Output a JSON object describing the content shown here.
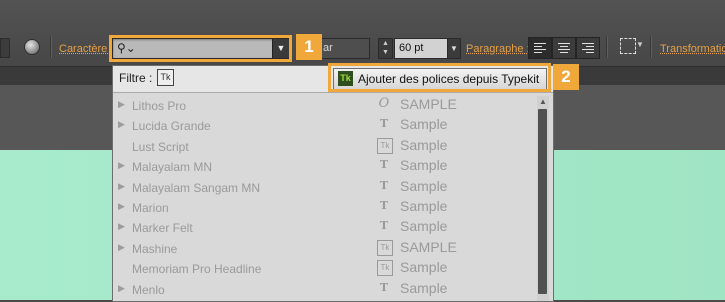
{
  "toolbar": {
    "caractere_label": "Caractère :",
    "font_field_value": "",
    "style_value": "ar",
    "size_value": "60 pt",
    "paragraphe_label": "Paragraphe :",
    "transformation_label": "Transformation"
  },
  "callouts": {
    "one": "1",
    "two": "2"
  },
  "accent_color": "#f0a83a",
  "canvas_color": "#a3e9c9",
  "panel": {
    "filter_label": "Filtre :",
    "filter_icon": "Tk",
    "typekit_icon": "Tk",
    "typekit_button": "Ajouter des polices depuis Typekit",
    "fonts": [
      {
        "name": "Lithos Pro",
        "icon": "O",
        "sample": "SAMPLE",
        "expandable": true
      },
      {
        "name": "Lucida Grande",
        "icon": "T",
        "sample": "Sample",
        "expandable": true
      },
      {
        "name": "Lust Script",
        "icon": "Tk",
        "sample": "Sample",
        "expandable": false
      },
      {
        "name": "Malayalam MN",
        "icon": "T",
        "sample": "Sample",
        "expandable": true
      },
      {
        "name": "Malayalam Sangam MN",
        "icon": "T",
        "sample": "Sample",
        "expandable": true
      },
      {
        "name": "Marion",
        "icon": "T",
        "sample": "Sample",
        "expandable": true
      },
      {
        "name": "Marker Felt",
        "icon": "T",
        "sample": "Sample",
        "expandable": true
      },
      {
        "name": "Mashine",
        "icon": "Tk",
        "sample": "SAMPLE",
        "expandable": true
      },
      {
        "name": "Memoriam Pro Headline",
        "icon": "Tk",
        "sample": "Sample",
        "expandable": false
      },
      {
        "name": "Menlo",
        "icon": "T",
        "sample": "Sample",
        "expandable": true
      }
    ]
  }
}
